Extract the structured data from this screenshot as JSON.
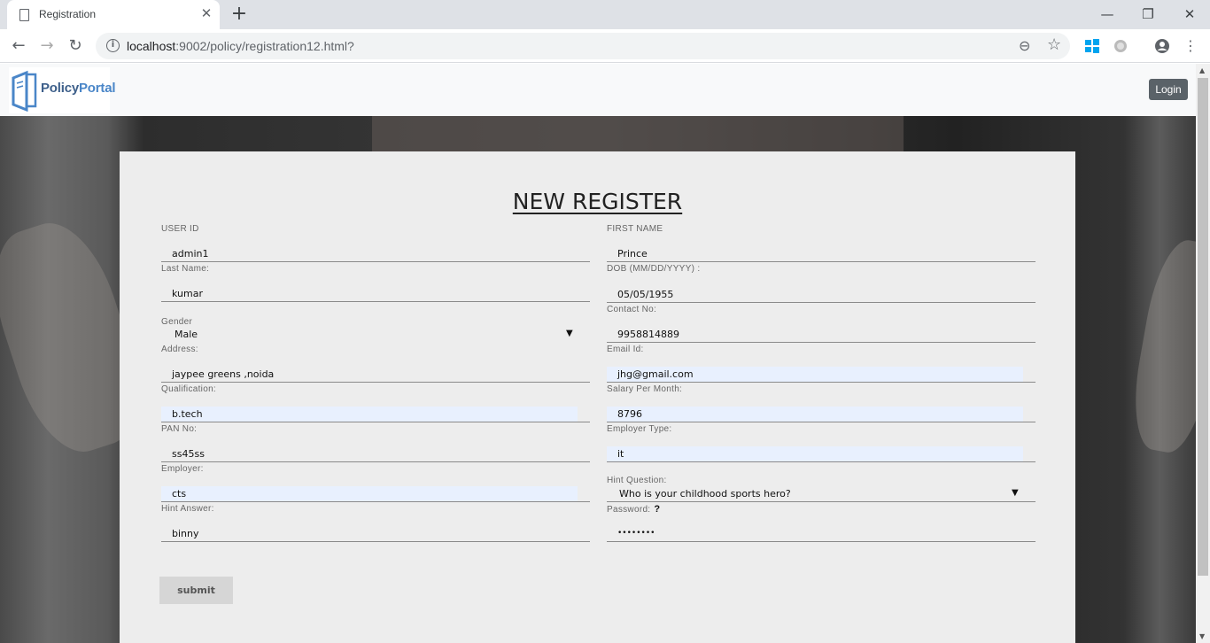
{
  "browser": {
    "tab_title": "Registration",
    "url_host": "localhost",
    "url_rest": ":9002/policy/registration12.html?"
  },
  "header": {
    "logo_text_policy": "Policy",
    "logo_text_portal": "Portal",
    "login_label": "Login"
  },
  "form": {
    "title": "NEW REGISTER",
    "submit_label": "submit",
    "fields": {
      "user_id": {
        "label": "USER ID",
        "value": "admin1"
      },
      "first_name": {
        "label": "FIRST NAME",
        "value": "Prince"
      },
      "last_name": {
        "label": "Last Name:",
        "value": "kumar"
      },
      "dob": {
        "label": "DOB (MM/DD/YYYY) :",
        "value": "05/05/1955"
      },
      "gender": {
        "label": "Gender",
        "value": "Male"
      },
      "contact": {
        "label": "Contact No:",
        "value": "9958814889"
      },
      "address": {
        "label": "Address:",
        "value": "jaypee greens ,noida"
      },
      "email": {
        "label": "Email Id:",
        "value": "jhg@gmail.com"
      },
      "qualification": {
        "label": "Qualification:",
        "value": "b.tech"
      },
      "salary": {
        "label": "Salary Per Month:",
        "value": "8796"
      },
      "pan": {
        "label": "PAN No:",
        "value": "ss45ss"
      },
      "employer_type": {
        "label": "Employer Type:",
        "value": "it"
      },
      "employer": {
        "label": "Employer:",
        "value": "cts"
      },
      "hint_question": {
        "label": "Hint Question:",
        "value": "Who is your childhood sports hero?"
      },
      "hint_answer": {
        "label": "Hint Answer:",
        "value": "binny"
      },
      "password": {
        "label": "Password:",
        "value": "••••••••",
        "help": "?"
      }
    }
  },
  "colors": {
    "autofill": "#e8f0fe",
    "panel": "#ededed",
    "login_button": "#5a6268"
  }
}
